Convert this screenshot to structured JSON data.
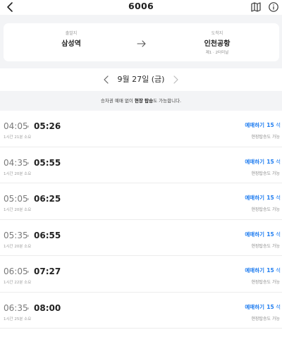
{
  "header": {
    "title": "6006",
    "back_icon": "chevron-left-icon",
    "map_icon": "map-icon",
    "info_icon": "info-icon"
  },
  "route": {
    "departure_label": "출발지",
    "departure": "삼성역",
    "arrival_label": "도착지",
    "arrival": "인천공항",
    "arrival_sub": "제1 · 2터미널"
  },
  "date": {
    "text": "9월 27일 (금)"
  },
  "notice": {
    "prefix": "승차권 예매 없이 ",
    "bold": "현장 탑승",
    "suffix": "도 가능합니다."
  },
  "schedules": [
    {
      "dep": "04:05",
      "arr": "05:26",
      "duration": "1시간 21분 소요",
      "book": "예매하기",
      "seats": "15",
      "seat_unit": "석",
      "onsite": "현장탑승도 가능"
    },
    {
      "dep": "04:35",
      "arr": "05:55",
      "duration": "1시간 20분 소요",
      "book": "예매하기",
      "seats": "15",
      "seat_unit": "석",
      "onsite": "현장탑승도 가능"
    },
    {
      "dep": "05:05",
      "arr": "06:25",
      "duration": "1시간 20분 소요",
      "book": "예매하기",
      "seats": "15",
      "seat_unit": "석",
      "onsite": "현장탑승도 가능"
    },
    {
      "dep": "05:35",
      "arr": "06:55",
      "duration": "1시간 20분 소요",
      "book": "예매하기",
      "seats": "15",
      "seat_unit": "석",
      "onsite": "현장탑승도 가능"
    },
    {
      "dep": "06:05",
      "arr": "07:27",
      "duration": "1시간 22분 소요",
      "book": "예매하기",
      "seats": "15",
      "seat_unit": "석",
      "onsite": "현장탑승도 가능"
    },
    {
      "dep": "06:35",
      "arr": "08:00",
      "duration": "1시간 25분 소요",
      "book": "예매하기",
      "seats": "15",
      "seat_unit": "석",
      "onsite": "현장탑승도 가능"
    }
  ],
  "colors": {
    "accent": "#1e7cf0",
    "muted_bg": "#f3f4f6"
  }
}
